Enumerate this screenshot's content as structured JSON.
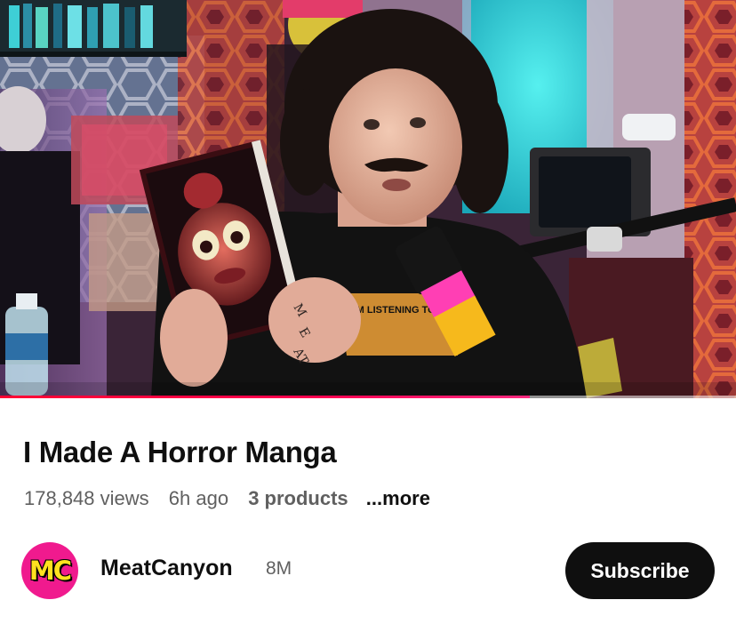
{
  "video": {
    "progress_fraction": 0.72,
    "poster_text": "I'M LISTENING TO"
  },
  "info": {
    "title": "I Made A Horror Manga",
    "views": "178,848 views",
    "age": "6h ago",
    "products": "3 products",
    "more": "...more"
  },
  "channel": {
    "avatar_text": "MC",
    "name": "MeatCanyon",
    "subscribers": "8M"
  },
  "actions": {
    "subscribe_label": "Subscribe"
  },
  "colors": {
    "progress": "#ff0033",
    "avatar_bg": "#f01a8e",
    "avatar_text": "#ffe21f",
    "subscribe_bg": "#0f0f0f"
  }
}
